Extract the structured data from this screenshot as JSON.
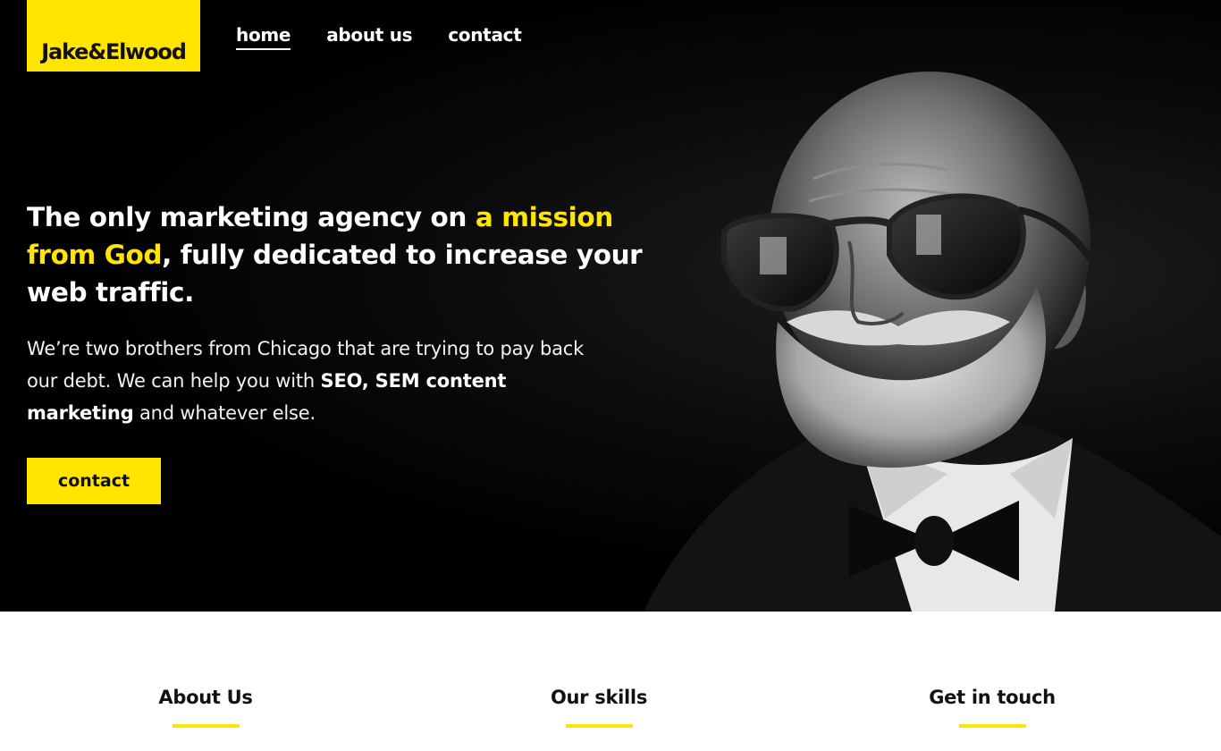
{
  "brand": {
    "logo_text": "Jake&Elwood",
    "accent_color": "#ffe500"
  },
  "nav": {
    "items": [
      {
        "label": "home",
        "active": true
      },
      {
        "label": "about us",
        "active": false
      },
      {
        "label": "contact",
        "active": false
      }
    ]
  },
  "hero": {
    "headline_part1": "The only marketing agency on ",
    "headline_highlight": "a mission from God",
    "headline_part2": ", fully dedicated to increase your web traffic.",
    "lead_part1": "We’re two brothers from Chicago that are trying to pay back our debt. We can help you with ",
    "lead_bold": "SEO, SEM content marketing",
    "lead_part2": " and whatever else.",
    "cta_label": "contact",
    "portrait_image": "man-with-sunglasses-and-bowtie-portrait"
  },
  "sections": [
    {
      "title": "About Us"
    },
    {
      "title": "Our skills"
    },
    {
      "title": "Get in touch"
    }
  ]
}
